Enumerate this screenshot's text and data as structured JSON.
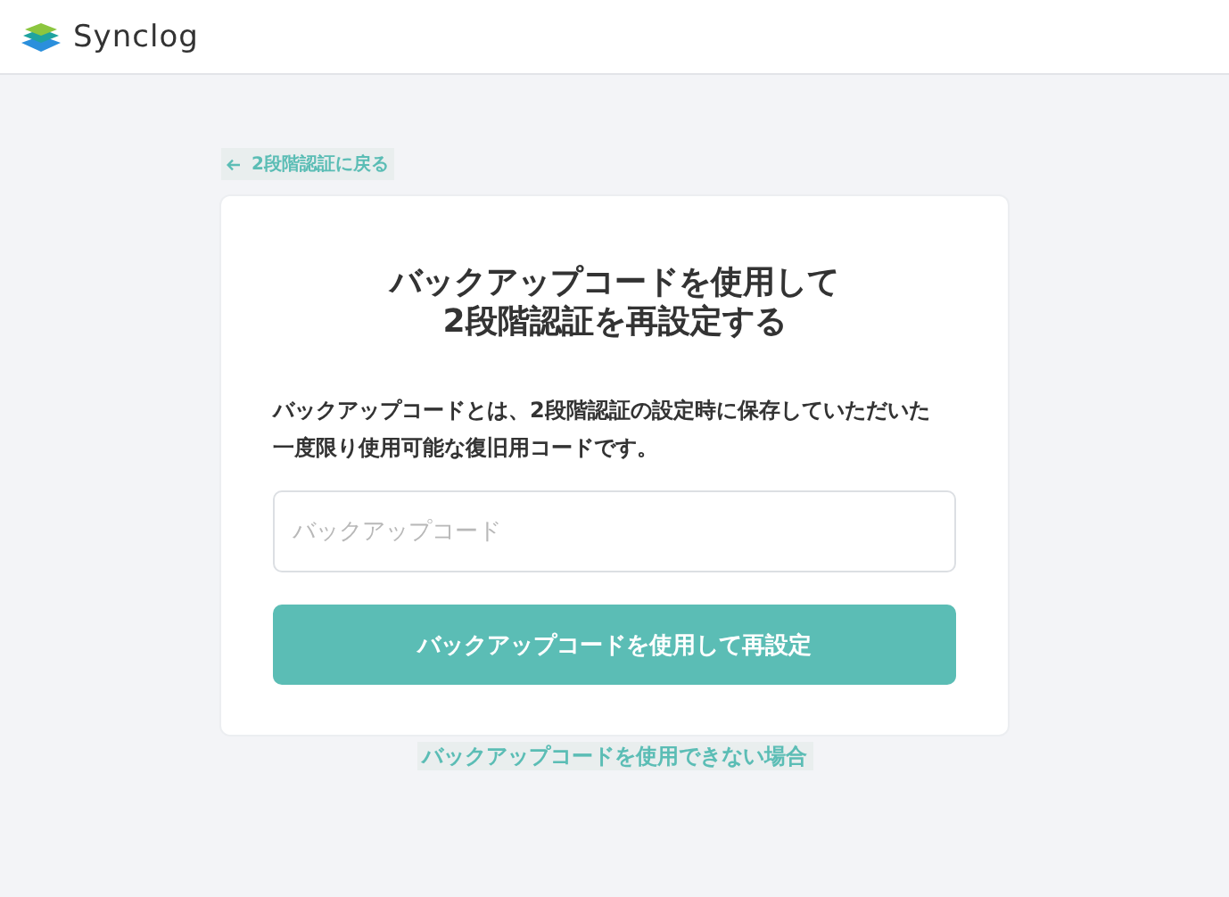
{
  "header": {
    "logo_text": "Synclog"
  },
  "back_link": {
    "label": "2段階認証に戻る"
  },
  "card": {
    "title_lines": [
      "バックアップコードを使用して",
      "2段階認証を再設定する"
    ],
    "description_lines": [
      "バックアップコードとは、2段階認証の設定時に保存していただいた",
      "一度限り使用可能な復旧用コードです。"
    ],
    "input": {
      "placeholder": "バックアップコード"
    },
    "submit_button": {
      "label": "バックアップコードを使用して再設定"
    }
  },
  "help_link": {
    "label": "バックアップコードを使用できない場合"
  }
}
